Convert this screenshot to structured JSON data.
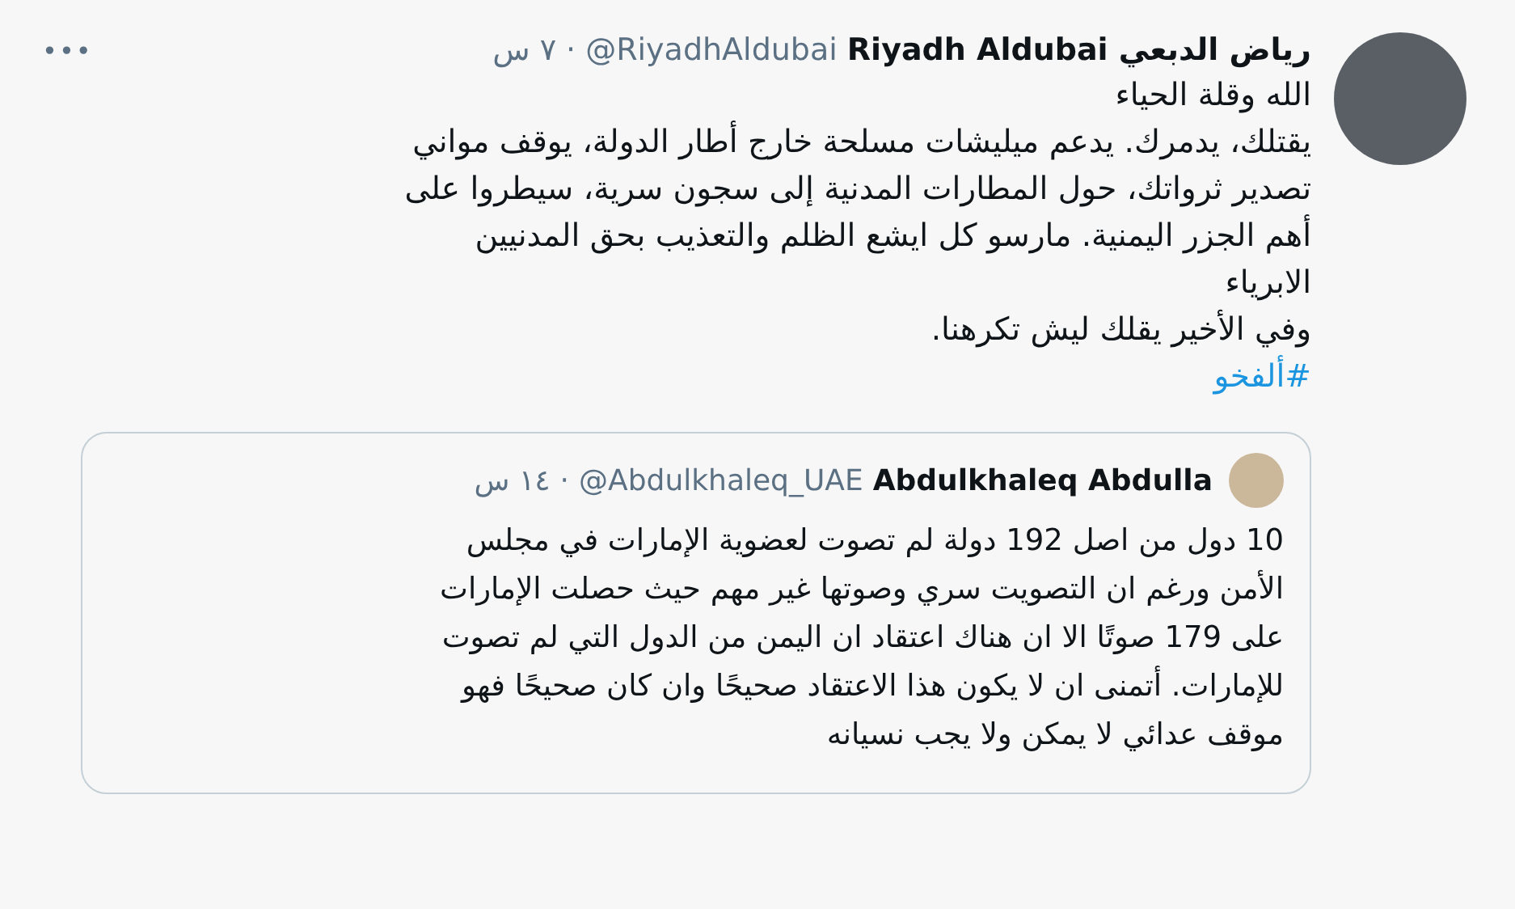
{
  "tweet": {
    "author_name": "رياض الدبعي Riyadh Aldubai",
    "handle": "@RiyadhAldubai",
    "separator": "·",
    "time": "٧ س",
    "more": "•••",
    "text_lines": [
      "الله وقلة الحياء",
      "يقتلك، يدمرك. يدعم ميليشات مسلحة خارج أطار الدولة، يوقف مواني",
      "تصدير ثرواتك، حول المطارات المدنية إلى سجون سرية، سيطروا على",
      "أهم الجزر اليمنية. مارسو كل ايشع الظلم والتعذيب بحق المدنيين",
      "الابرياء",
      "وفي الأخير يقلك ليش تكرهنا."
    ],
    "hashtag": "#ألفخو",
    "quoted": {
      "author_name": "Abdulkhaleq Abdulla",
      "handle": "@Abdulkhaleq_UAE",
      "separator": "·",
      "time": "١٤ س",
      "text_lines": [
        "10 دول من اصل 192 دولة لم تصوت لعضوية الإمارات في مجلس",
        "الأمن ورغم ان التصويت سري وصوتها غير مهم حيث حصلت الإمارات",
        "على 179 صوتًا الا ان هناك اعتقاد ان اليمن من الدول التي لم تصوت",
        "للإمارات. أتمنى ان لا يكون هذا الاعتقاد صحيحًا وان كان صحيحًا فهو",
        "موقف عدائي لا يمكن ولا يجب نسيانه"
      ]
    }
  }
}
